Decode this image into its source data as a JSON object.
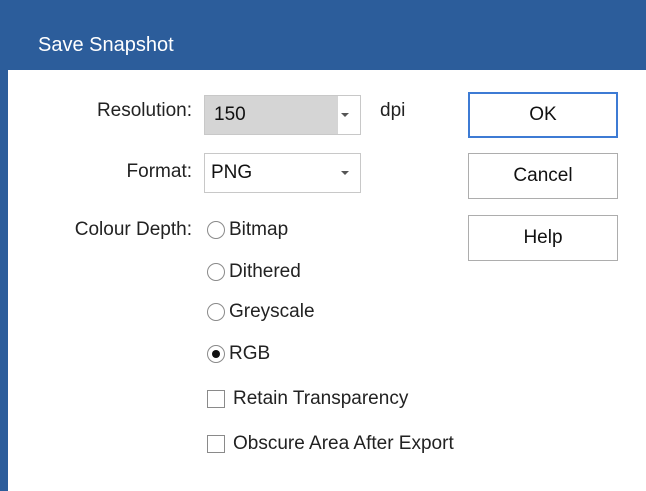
{
  "window": {
    "title": "Save Snapshot"
  },
  "form": {
    "resolution": {
      "label": "Resolution:",
      "value": "150",
      "unit": "dpi"
    },
    "format": {
      "label": "Format:",
      "value": "PNG"
    },
    "colour_depth": {
      "label": "Colour Depth:",
      "options": [
        {
          "label": "Bitmap",
          "checked": false
        },
        {
          "label": "Dithered",
          "checked": false
        },
        {
          "label": "Greyscale",
          "checked": false
        },
        {
          "label": "RGB",
          "checked": true
        }
      ]
    },
    "checkboxes": [
      {
        "label": "Retain Transparency",
        "checked": false
      },
      {
        "label": "Obscure Area After Export",
        "checked": false
      }
    ]
  },
  "buttons": {
    "ok": "OK",
    "cancel": "Cancel",
    "help": "Help"
  },
  "colors": {
    "titlebar": "#2c5d9b",
    "default_button_border": "#3d7bd4"
  }
}
